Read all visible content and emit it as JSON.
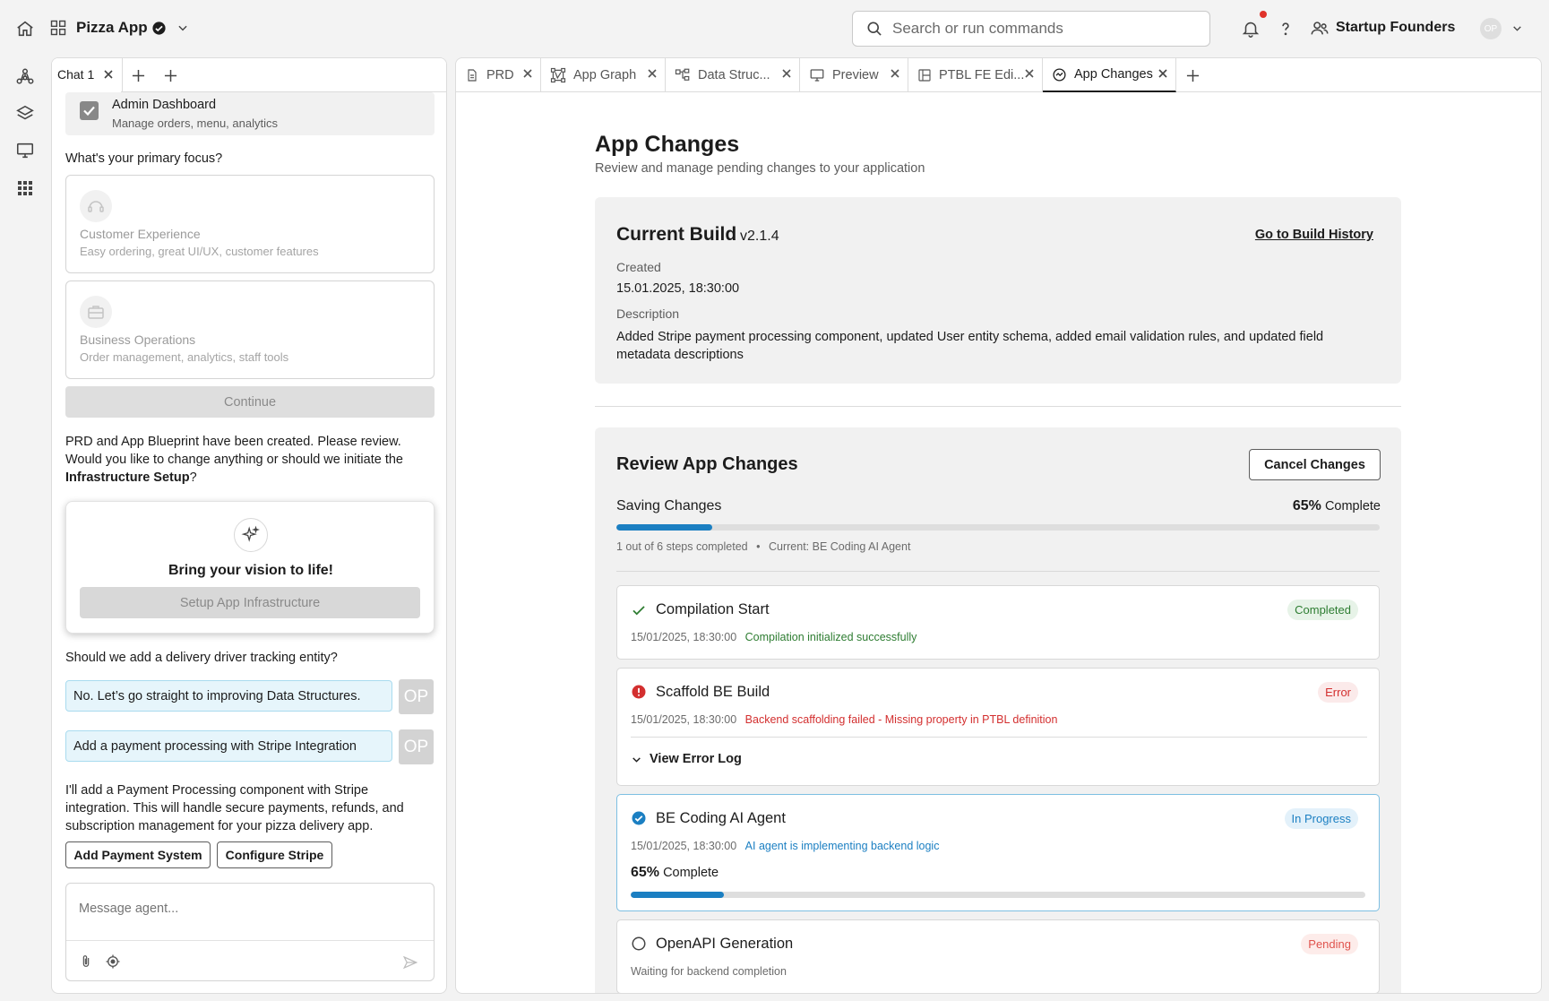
{
  "topbar": {
    "project_name": "Pizza App",
    "search_placeholder": "Search or run commands",
    "team_name": "Startup Founders",
    "avatar_initials": "OP"
  },
  "chat": {
    "tab_label": "Chat 1",
    "admin_card": {
      "title": "Admin Dashboard",
      "subtitle": "Manage orders, menu, analytics"
    },
    "focus_question": "What's your primary focus?",
    "options": [
      {
        "title": "Customer Experience",
        "subtitle": "Easy ordering, great UI/UX, customer features"
      },
      {
        "title": "Business Operations",
        "subtitle": "Order management, analytics, staff tools"
      }
    ],
    "continue_label": "Continue",
    "prd_text_1": "PRD and App Blueprint have been created. Please review. Would you like to change anything or should we initiate the ",
    "prd_text_bold": "Infrastructure Setup",
    "prd_text_end": "?",
    "vision_title": "Bring your vision to life!",
    "setup_label": "Setup App Infrastructure",
    "driver_question": "Should we add a delivery driver tracking entity?",
    "user_messages": [
      "No. Let’s go straight to improving Data Structures.",
      "Add a payment processing with Stripe Integration"
    ],
    "user_avatar": "OP",
    "agent_reply": "I'll add a Payment Processing component with Stripe integration. This will handle secure payments, refunds, and subscription management for your pizza delivery app.",
    "action_buttons": [
      "Add Payment System",
      "Configure Stripe"
    ],
    "message_placeholder": "Message agent..."
  },
  "tabs": [
    {
      "label": "PRD",
      "icon": "document-icon"
    },
    {
      "label": "App Graph",
      "icon": "graph-icon"
    },
    {
      "label": "Data Struc...",
      "icon": "data-structure-icon"
    },
    {
      "label": "Preview",
      "icon": "monitor-icon"
    },
    {
      "label": "PTBL FE Edi...",
      "icon": "layout-icon"
    },
    {
      "label": "App Changes",
      "icon": "changes-icon",
      "active": true
    }
  ],
  "page": {
    "title": "App Changes",
    "subtitle": "Review and manage pending changes to your application",
    "build": {
      "title": "Current Build",
      "version": "v2.1.4",
      "history_link": "Go to Build History",
      "created_label": "Created",
      "created_value": "15.01.2025, 18:30:00",
      "description_label": "Description",
      "description_value": "Added Stripe payment processing component, updated User entity schema, added email validation rules, and updated field metadata descriptions"
    },
    "review": {
      "title": "Review App Changes",
      "cancel_label": "Cancel Changes",
      "saving_label": "Saving Changes",
      "progress_percent": "65%",
      "progress_fraction": 0.126,
      "complete_word": "Complete",
      "steps_summary": "1 out of 6 steps completed",
      "current_label": "Current: BE Coding AI Agent",
      "steps": [
        {
          "title": "Compilation Start",
          "status": "Completed",
          "timestamp": "15/01/2025, 18:30:00",
          "message": "Compilation initialized successfully"
        },
        {
          "title": "Scaffold BE Build",
          "status": "Error",
          "timestamp": "15/01/2025, 18:30:00",
          "message": "Backend scaffolding failed - Missing property in PTBL definition",
          "toggle_label": "View Error Log"
        },
        {
          "title": "BE Coding AI Agent",
          "status": "In Progress",
          "timestamp": "15/01/2025, 18:30:00",
          "message": "AI agent is implementing backend logic",
          "progress_percent": "65%",
          "progress_fraction": 0.127,
          "complete_word": "Complete"
        },
        {
          "title": "OpenAPI Generation",
          "status": "Pending",
          "message": "Waiting for backend completion"
        }
      ]
    }
  },
  "colors": {
    "accent": "#1b7fc2",
    "success": "#2e7d32",
    "error": "#d32f2f",
    "pending": "#e0534d"
  }
}
